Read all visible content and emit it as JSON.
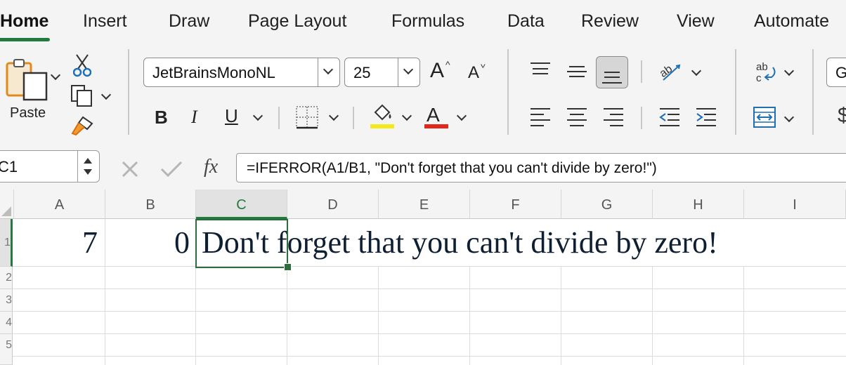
{
  "tabs": [
    {
      "label": "Home",
      "active": true
    },
    {
      "label": "Insert"
    },
    {
      "label": "Draw"
    },
    {
      "label": "Page Layout"
    },
    {
      "label": "Formulas"
    },
    {
      "label": "Data"
    },
    {
      "label": "Review"
    },
    {
      "label": "View"
    },
    {
      "label": "Automate"
    }
  ],
  "clipboard": {
    "paste_label": "Paste"
  },
  "font": {
    "name": "JetBrainsMonoNL",
    "size": "25"
  },
  "format": {
    "bold": "B",
    "italic": "I",
    "underline": "U",
    "font_color_glyph": "A",
    "grow_glyph": "A",
    "shrink_glyph": "A",
    "highlight_color": "#f2ea1c",
    "font_color": "#e3261b"
  },
  "partial": {
    "number_format": "G",
    "currency": "$"
  },
  "formula_bar": {
    "name_box": "C1",
    "fx": "fx",
    "formula": "=IFERROR(A1/B1, \"Don't forget that you can't divide by zero!\")"
  },
  "columns": [
    "A",
    "B",
    "C",
    "D",
    "E",
    "F",
    "G",
    "H",
    "I"
  ],
  "rows": [
    "1",
    "2",
    "3",
    "4",
    "5"
  ],
  "cells": {
    "A1": "7",
    "B1": "0",
    "C1": "Don't forget that you can't divide by zero!"
  },
  "accent": "#237a3e"
}
